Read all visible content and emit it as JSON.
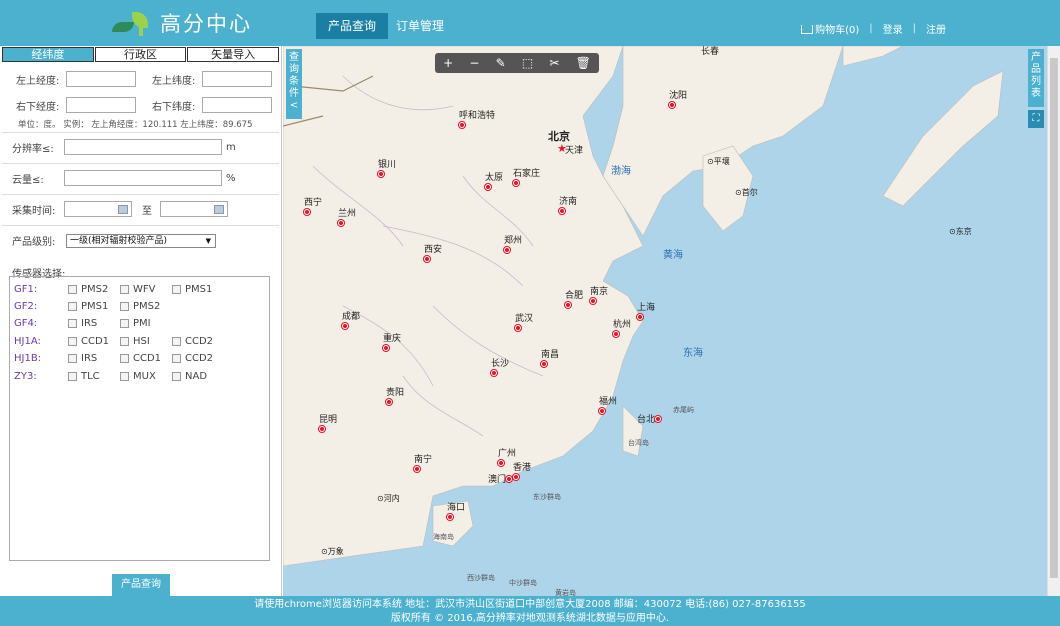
{
  "header": {
    "logo_text": "高分中心",
    "nav": [
      "产品查询",
      "订单管理"
    ],
    "cart": "购物车(0)",
    "login": "登录",
    "register": "注册"
  },
  "left_panel": {
    "tabs": [
      "经纬度",
      "行政区",
      "矢量导入"
    ],
    "upper_left_lon": "左上经度:",
    "upper_left_lat": "左上纬度:",
    "lower_right_lon": "右下经度:",
    "lower_right_lat": "右下纬度:",
    "hint": "单位：度。  实例：  左上角经度：120.111     左上纬度：89.675",
    "resolution_label": "分辨率≤:",
    "resolution_unit": "m",
    "cloud_label": "云量≤:",
    "cloud_unit": "%",
    "time_label": "采集时间:",
    "time_to": "至",
    "level_label": "产品级别:",
    "level_value": "一级(相对辐射校验产品)",
    "sensor_label": "传感器选择:",
    "sensors": [
      {
        "name": "GF1:",
        "options": [
          "PMS2",
          "WFV",
          "PMS1"
        ]
      },
      {
        "name": "GF2:",
        "options": [
          "PMS1",
          "PMS2"
        ]
      },
      {
        "name": "GF4:",
        "options": [
          "IRS",
          "PMI"
        ]
      },
      {
        "name": "HJ1A:",
        "options": [
          "CCD1",
          "HSI",
          "CCD2"
        ]
      },
      {
        "name": "HJ1B:",
        "options": [
          "IRS",
          "CCD1",
          "CCD2"
        ]
      },
      {
        "name": "ZY3:",
        "options": [
          "TLC",
          "MUX",
          "NAD"
        ]
      }
    ],
    "query_button": "产品查询"
  },
  "map": {
    "query_tab": "查询条件<",
    "product_tab": "产品列表",
    "toolbar": [
      "+",
      "−",
      "✎",
      "⬚",
      "✂",
      "🗑"
    ],
    "cities": [
      {
        "name": "长春"
      },
      {
        "name": "沈阳"
      },
      {
        "name": "呼和浩特"
      },
      {
        "name": "北京"
      },
      {
        "name": "天津"
      },
      {
        "name": "银川"
      },
      {
        "name": "太原"
      },
      {
        "name": "石家庄"
      },
      {
        "name": "西宁"
      },
      {
        "name": "兰州"
      },
      {
        "name": "济南"
      },
      {
        "name": "郑州"
      },
      {
        "name": "西安"
      },
      {
        "name": "合肥"
      },
      {
        "name": "南京"
      },
      {
        "name": "上海"
      },
      {
        "name": "成都"
      },
      {
        "name": "武汉"
      },
      {
        "name": "杭州"
      },
      {
        "name": "重庆"
      },
      {
        "name": "长沙"
      },
      {
        "name": "南昌"
      },
      {
        "name": "贵阳"
      },
      {
        "name": "福州"
      },
      {
        "name": "台北"
      },
      {
        "name": "昆明"
      },
      {
        "name": "广州"
      },
      {
        "name": "南宁"
      },
      {
        "name": "香港"
      },
      {
        "name": "澳门"
      },
      {
        "name": "海口"
      },
      {
        "name": "平壤"
      },
      {
        "name": "首尔"
      },
      {
        "name": "东京"
      },
      {
        "name": "河内"
      },
      {
        "name": "万象"
      },
      {
        "name": "海南岛"
      },
      {
        "name": "台湾岛"
      },
      {
        "name": "东沙群岛"
      },
      {
        "name": "西沙群岛"
      },
      {
        "name": "中沙群岛"
      },
      {
        "name": "赤尾屿"
      },
      {
        "name": "黄岩岛"
      }
    ],
    "seas": [
      "渤海",
      "黄海",
      "东海"
    ]
  },
  "footer": {
    "line1": "请使用chrome浏览器访问本系统    地址：武汉市洪山区街道口中部创意大厦2008    邮编：430072    电话:(86) 027-87636155",
    "line2": "版权所有 © 2016,高分辨率对地观测系统湖北数据与应用中心."
  }
}
